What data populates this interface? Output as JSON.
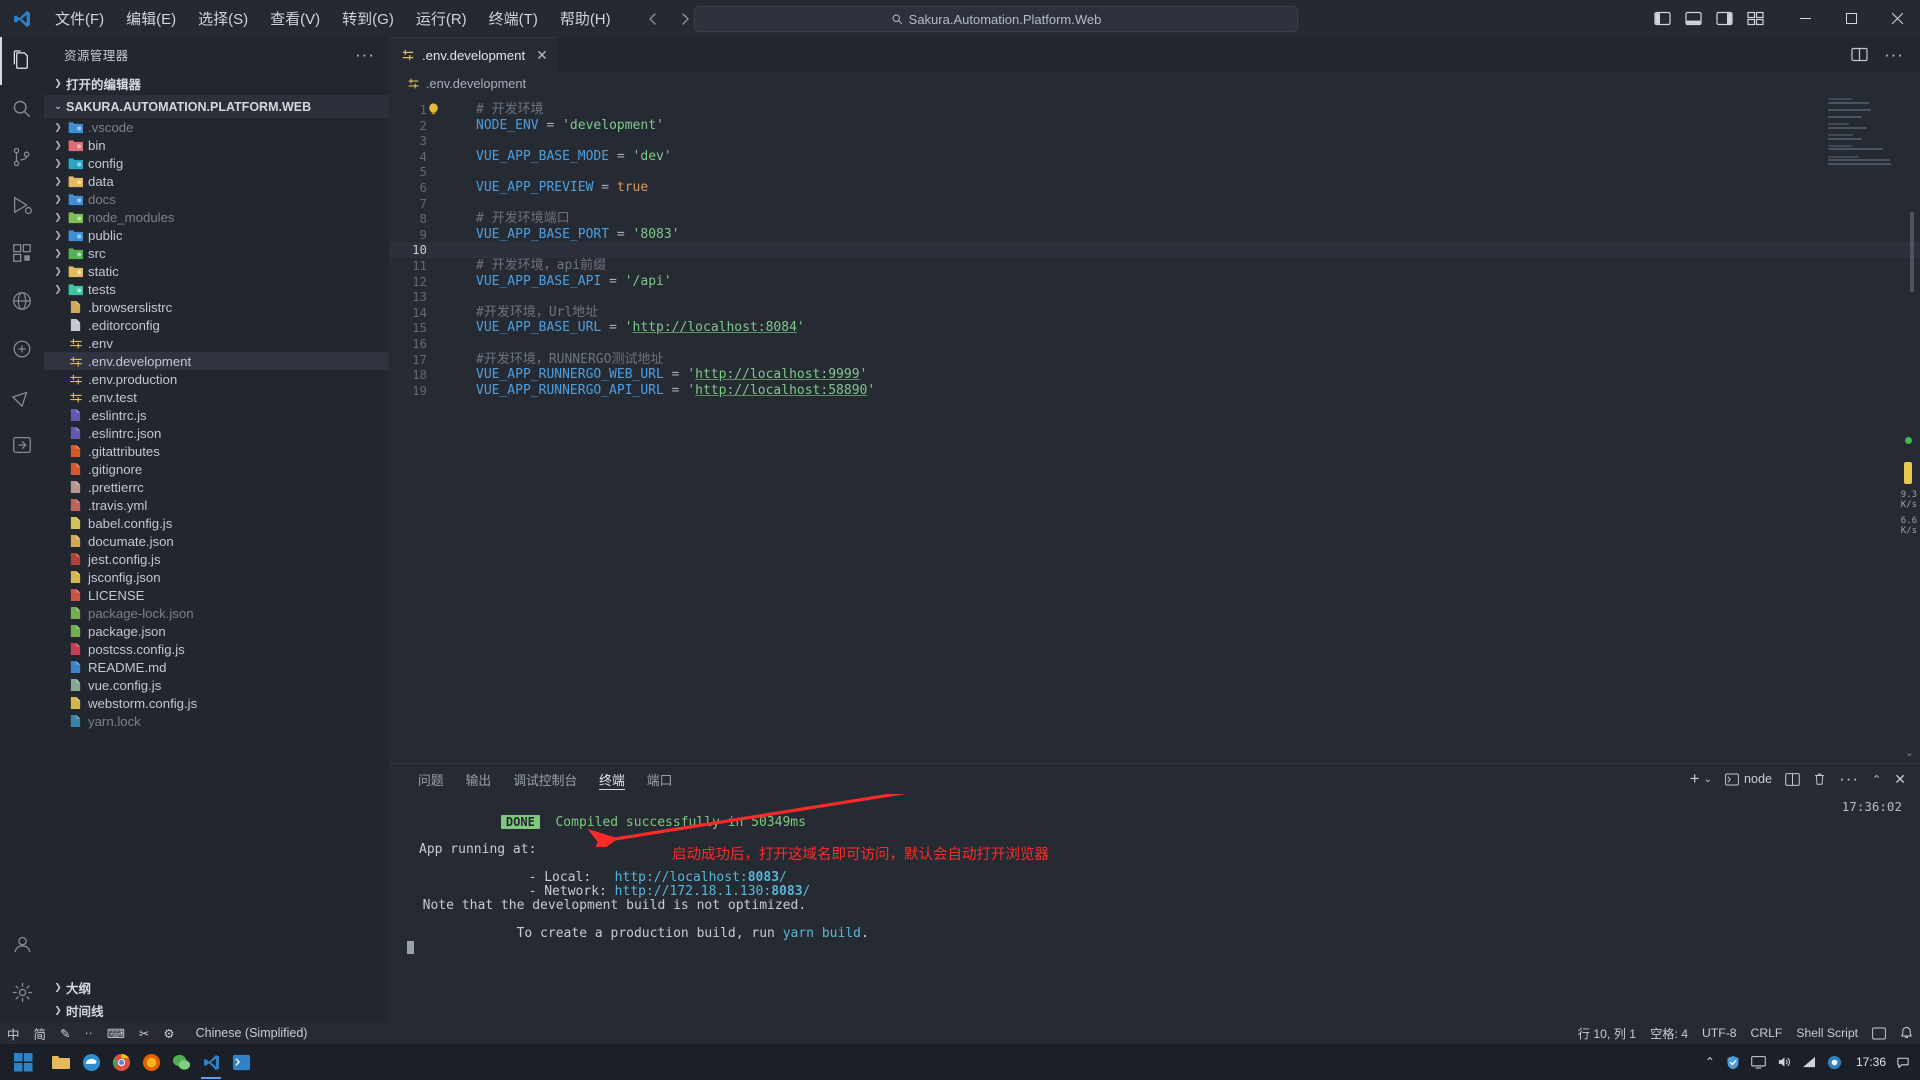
{
  "titlebar": {
    "logo_icon": "vscode-logo-icon",
    "menu": [
      {
        "label": "文件(F)",
        "name": "menu-file"
      },
      {
        "label": "编辑(E)",
        "name": "menu-edit"
      },
      {
        "label": "选择(S)",
        "name": "menu-selection"
      },
      {
        "label": "查看(V)",
        "name": "menu-view"
      },
      {
        "label": "转到(G)",
        "name": "menu-go"
      },
      {
        "label": "运行(R)",
        "name": "menu-run"
      },
      {
        "label": "终端(T)",
        "name": "menu-terminal"
      },
      {
        "label": "帮助(H)",
        "name": "menu-help"
      }
    ],
    "back_icon": "arrow-left-icon",
    "forward_icon": "arrow-right-icon",
    "command_center_text": "Sakura.Automation.Platform.Web",
    "command_center_icon": "search-icon",
    "window_controls": {
      "minimize": "─",
      "maximize": "▢",
      "close": "✕"
    }
  },
  "activitybar": {
    "items": [
      {
        "name": "activity-explorer",
        "icon": "files-icon",
        "active": true
      },
      {
        "name": "activity-search",
        "icon": "search-icon",
        "active": false
      },
      {
        "name": "activity-scm",
        "icon": "source-control-icon",
        "active": false
      },
      {
        "name": "activity-debug",
        "icon": "run-and-debug-icon",
        "active": false
      },
      {
        "name": "activity-extensions",
        "icon": "extensions-icon",
        "active": false
      },
      {
        "name": "activity-remote",
        "icon": "remote-explorer-icon",
        "active": false
      },
      {
        "name": "activity-docker",
        "icon": "docker-icon",
        "active": false
      },
      {
        "name": "activity-testing",
        "icon": "beaker-icon",
        "active": false
      },
      {
        "name": "activity-import",
        "icon": "import-icon",
        "active": false
      }
    ],
    "bottom": [
      {
        "name": "activity-accounts",
        "icon": "account-icon"
      },
      {
        "name": "activity-settings",
        "icon": "gear-icon"
      }
    ]
  },
  "sidebar": {
    "title": "资源管理器",
    "more_actions_icon": "ellipsis-icon",
    "open_editors_label": "打开的编辑器",
    "project_label": "SAKURA.AUTOMATION.PLATFORM.WEB",
    "tree": [
      {
        "label": ".vscode",
        "type": "folder",
        "icon_color": "#3f8fd8",
        "dim": true
      },
      {
        "label": "bin",
        "type": "folder",
        "icon_color": "#e06c75",
        "dim": false
      },
      {
        "label": "config",
        "type": "folder",
        "icon_color": "#2aa6c4",
        "dim": false
      },
      {
        "label": "data",
        "type": "folder",
        "icon_color": "#e5b95c",
        "dim": false
      },
      {
        "label": "docs",
        "type": "folder",
        "icon_color": "#3f8fd8",
        "dim": true
      },
      {
        "label": "node_modules",
        "type": "folder",
        "icon_color": "#7bbf56",
        "dim": true
      },
      {
        "label": "public",
        "type": "folder",
        "icon_color": "#3f8fd8",
        "dim": false
      },
      {
        "label": "src",
        "type": "folder",
        "icon_color": "#54b158",
        "dim": false
      },
      {
        "label": "static",
        "type": "folder",
        "icon_color": "#e5b95c",
        "dim": false
      },
      {
        "label": "tests",
        "type": "folder",
        "icon_color": "#3fc4a0",
        "dim": false
      },
      {
        "label": ".browserslistrc",
        "type": "file",
        "icon": "browserslist-icon",
        "icon_color": "#e5b95c",
        "dim": false
      },
      {
        "label": ".editorconfig",
        "type": "file",
        "icon": "editorconfig-icon",
        "icon_color": "#d6dbe3",
        "dim": false
      },
      {
        "label": ".env",
        "type": "file",
        "icon": "env-icon",
        "icon_color": "#e5b95c",
        "dim": false
      },
      {
        "label": ".env.development",
        "type": "file",
        "icon": "env-icon",
        "icon_color": "#e5b95c",
        "dim": false,
        "selected": true
      },
      {
        "label": ".env.production",
        "type": "file",
        "icon": "env-icon",
        "icon_color": "#e5b95c",
        "dim": false
      },
      {
        "label": ".env.test",
        "type": "file",
        "icon": "env-icon",
        "icon_color": "#e5b95c",
        "dim": false
      },
      {
        "label": ".eslintrc.js",
        "type": "file",
        "icon": "eslint-icon",
        "icon_color": "#6a5fc4",
        "dim": false
      },
      {
        "label": ".eslintrc.json",
        "type": "file",
        "icon": "eslint-icon",
        "icon_color": "#6a5fc4",
        "dim": false
      },
      {
        "label": ".gitattributes",
        "type": "file",
        "icon": "git-icon",
        "icon_color": "#e8612c",
        "dim": false
      },
      {
        "label": ".gitignore",
        "type": "file",
        "icon": "git-icon",
        "icon_color": "#e8612c",
        "dim": false
      },
      {
        "label": ".prettierrc",
        "type": "file",
        "icon": "prettier-icon",
        "icon_color": "#c9a3a0",
        "dim": false
      },
      {
        "label": ".travis.yml",
        "type": "file",
        "icon": "travis-icon",
        "icon_color": "#cf6a5a",
        "dim": false
      },
      {
        "label": "babel.config.js",
        "type": "file",
        "icon": "babel-icon",
        "icon_color": "#e5d35c",
        "dim": false
      },
      {
        "label": "documate.json",
        "type": "file",
        "icon": "json-icon",
        "icon_color": "#e5b95c",
        "dim": false
      },
      {
        "label": "jest.config.js",
        "type": "file",
        "icon": "jest-icon",
        "icon_color": "#c2443d",
        "dim": false
      },
      {
        "label": "jsconfig.json",
        "type": "file",
        "icon": "js-config-icon",
        "icon_color": "#e5c84c",
        "dim": false
      },
      {
        "label": "LICENSE",
        "type": "file",
        "icon": "license-icon",
        "icon_color": "#e05a45",
        "dim": false
      },
      {
        "label": "package-lock.json",
        "type": "file",
        "icon": "npm-icon",
        "icon_color": "#7bbf56",
        "dim": true
      },
      {
        "label": "package.json",
        "type": "file",
        "icon": "npm-icon",
        "icon_color": "#7bbf56",
        "dim": false
      },
      {
        "label": "postcss.config.js",
        "type": "file",
        "icon": "postcss-icon",
        "icon_color": "#d9415c",
        "dim": false
      },
      {
        "label": "README.md",
        "type": "file",
        "icon": "readme-icon",
        "icon_color": "#3f8fd8",
        "dim": false
      },
      {
        "label": "vue.config.js",
        "type": "file",
        "icon": "vue-config-icon",
        "icon_color": "#8fb9a3",
        "dim": false
      },
      {
        "label": "webstorm.config.js",
        "type": "file",
        "icon": "js-icon",
        "icon_color": "#e5c84c",
        "dim": false
      },
      {
        "label": "yarn.lock",
        "type": "file",
        "icon": "yarn-icon",
        "icon_color": "#3b8fb5",
        "dim": true
      }
    ],
    "footer": [
      {
        "label": "大纲",
        "name": "sidebar-section-outline"
      },
      {
        "label": "时间线",
        "name": "sidebar-section-timeline"
      }
    ]
  },
  "editor": {
    "tab": {
      "label": ".env.development",
      "icon": "env-icon",
      "close_icon": "close-icon"
    },
    "actions": {
      "split_icon": "split-editor-icon",
      "more_icon": "ellipsis-icon"
    },
    "breadcrumb": ".env.development",
    "lines": [
      {
        "n": 1,
        "tokens": [
          {
            "t": "# 开发环境",
            "c": "k-com"
          }
        ]
      },
      {
        "n": 2,
        "tokens": [
          {
            "t": "NODE_ENV",
            "c": "k-var"
          },
          {
            "t": " = ",
            "c": "k-op"
          },
          {
            "t": "'development'",
            "c": "k-str"
          }
        ]
      },
      {
        "n": 3,
        "tokens": []
      },
      {
        "n": 4,
        "tokens": [
          {
            "t": "VUE_APP_BASE_MODE",
            "c": "k-var"
          },
          {
            "t": " = ",
            "c": "k-op"
          },
          {
            "t": "'dev'",
            "c": "k-str"
          }
        ]
      },
      {
        "n": 5,
        "tokens": []
      },
      {
        "n": 6,
        "tokens": [
          {
            "t": "VUE_APP_PREVIEW",
            "c": "k-var"
          },
          {
            "t": " = ",
            "c": "k-op"
          },
          {
            "t": "true",
            "c": "k-bool"
          }
        ]
      },
      {
        "n": 7,
        "tokens": []
      },
      {
        "n": 8,
        "tokens": [
          {
            "t": "# 开发环境端口",
            "c": "k-com"
          }
        ]
      },
      {
        "n": 9,
        "tokens": [
          {
            "t": "VUE_APP_BASE_PORT",
            "c": "k-var"
          },
          {
            "t": " = ",
            "c": "k-op"
          },
          {
            "t": "'8083'",
            "c": "k-str"
          }
        ],
        "lightbulb": true
      },
      {
        "n": 10,
        "tokens": [],
        "current": true
      },
      {
        "n": 11,
        "tokens": [
          {
            "t": "# 开发环境，api前缀",
            "c": "k-com"
          }
        ]
      },
      {
        "n": 12,
        "tokens": [
          {
            "t": "VUE_APP_BASE_API",
            "c": "k-var"
          },
          {
            "t": " = ",
            "c": "k-op"
          },
          {
            "t": "'/api'",
            "c": "k-str"
          }
        ]
      },
      {
        "n": 13,
        "tokens": []
      },
      {
        "n": 14,
        "tokens": [
          {
            "t": "#开发环境，Url地址",
            "c": "k-com"
          }
        ]
      },
      {
        "n": 15,
        "tokens": [
          {
            "t": "VUE_APP_BASE_URL",
            "c": "k-var"
          },
          {
            "t": " = ",
            "c": "k-op"
          },
          {
            "t": "'",
            "c": "k-str"
          },
          {
            "t": "http://localhost:8084",
            "c": "k-url"
          },
          {
            "t": "'",
            "c": "k-str"
          }
        ]
      },
      {
        "n": 16,
        "tokens": []
      },
      {
        "n": 17,
        "tokens": [
          {
            "t": "#开发环境，RUNNERGO测试地址",
            "c": "k-com"
          }
        ]
      },
      {
        "n": 18,
        "tokens": [
          {
            "t": "VUE_APP_RUNNERGO_WEB_URL",
            "c": "k-var"
          },
          {
            "t": " = ",
            "c": "k-op"
          },
          {
            "t": "'",
            "c": "k-str"
          },
          {
            "t": "http://localhost:9999",
            "c": "k-url"
          },
          {
            "t": "'",
            "c": "k-str"
          }
        ]
      },
      {
        "n": 19,
        "tokens": [
          {
            "t": "VUE_APP_RUNNERGO_API_URL",
            "c": "k-var"
          },
          {
            "t": " = ",
            "c": "k-op"
          },
          {
            "t": "'",
            "c": "k-str"
          },
          {
            "t": "http://localhost:58890",
            "c": "k-url"
          },
          {
            "t": "'",
            "c": "k-str"
          }
        ]
      }
    ],
    "network_stats": [
      {
        "value": "9.3",
        "unit": "K/s"
      },
      {
        "value": "6.6",
        "unit": "K/s"
      }
    ]
  },
  "panel": {
    "tabs": [
      {
        "label": "问题",
        "name": "panel-tab-problems",
        "active": false
      },
      {
        "label": "输出",
        "name": "panel-tab-output",
        "active": false
      },
      {
        "label": "调试控制台",
        "name": "panel-tab-debug-console",
        "active": false
      },
      {
        "label": "终端",
        "name": "panel-tab-terminal",
        "active": true
      },
      {
        "label": "端口",
        "name": "panel-tab-ports",
        "active": false
      }
    ],
    "actions": {
      "new_terminal_icon": "plus-icon",
      "dropdown_icon": "chevron-down-icon",
      "shell_icon": "terminal-icon",
      "shell_label": "node",
      "split_icon": "split-terminal-icon",
      "kill_icon": "trash-icon",
      "more_icon": "ellipsis-icon",
      "maximize_icon": "chevron-up-icon",
      "close_icon": "close-icon"
    },
    "terminal": {
      "timestamp": "17:36:02",
      "done_badge": "DONE",
      "compiled_text": "Compiled successfully in 50349ms",
      "app_running_at": "App running at:",
      "local_label": "  - Local:   ",
      "local_url_prefix": "http://localhost:",
      "local_url_port": "8083",
      "local_url_suffix": "/",
      "network_label": "  - Network: ",
      "network_url_prefix": "http://172.18.1.130:",
      "network_url_port": "8083",
      "network_url_suffix": "/",
      "note_line1": "  Note that the development build is not optimized.",
      "note_line2_a": "  To create a production build, run ",
      "note_line2_b": "yarn build",
      "note_line2_c": "."
    },
    "annotation": "启动成功后，打开这域名即可访问，默认会自动打开浏览器"
  },
  "statusbar": {
    "left": [
      {
        "label": "中",
        "name": "status-ime-cn"
      },
      {
        "label": "简",
        "name": "status-ime-simplified"
      },
      {
        "label": "✎",
        "name": "status-ime-pen"
      },
      {
        "label": "··",
        "name": "status-ime-dots"
      },
      {
        "label": "⌨",
        "name": "status-ime-keyboard"
      },
      {
        "label": "✂",
        "name": "status-ime-tools"
      },
      {
        "label": "⚙",
        "name": "status-ime-settings"
      },
      {
        "label": "Chinese (Simplified)",
        "name": "status-ime-language"
      }
    ],
    "right": [
      {
        "label": "行 10, 列 1",
        "name": "status-cursor-position"
      },
      {
        "label": "空格: 4",
        "name": "status-indentation"
      },
      {
        "label": "UTF-8",
        "name": "status-encoding"
      },
      {
        "label": "CRLF",
        "name": "status-eol"
      },
      {
        "label": "Shell Script",
        "name": "status-language-mode"
      },
      {
        "label": "⧉",
        "name": "status-screencast-icon"
      },
      {
        "label": "🔔",
        "name": "status-notifications-icon"
      }
    ]
  },
  "taskbar": {
    "start_icon": "windows-start-icon",
    "apps": [
      {
        "name": "taskbar-file-explorer",
        "icon": "folder-icon",
        "color": "#e5b95c"
      },
      {
        "name": "taskbar-edge",
        "icon": "edge-icon",
        "color": "#3aa0d8"
      },
      {
        "name": "taskbar-chrome",
        "icon": "chrome-icon",
        "color": "#dd5144"
      },
      {
        "name": "taskbar-firefox",
        "icon": "firefox-icon",
        "color": "#e66000"
      },
      {
        "name": "taskbar-wechat",
        "icon": "wechat-icon",
        "color": "#4caf50"
      },
      {
        "name": "taskbar-vscode",
        "icon": "vscode-icon",
        "color": "#2f82c6",
        "active": true
      },
      {
        "name": "taskbar-terminal",
        "icon": "terminal-app-icon",
        "color": "#2f82c6"
      }
    ],
    "tray": [
      {
        "name": "tray-chevron-up-icon",
        "glyph": "⌃"
      },
      {
        "name": "tray-shield-icon",
        "glyph": "🛡"
      },
      {
        "name": "tray-screen-icon",
        "glyph": "▭"
      },
      {
        "name": "tray-volume-icon",
        "glyph": "🔊"
      },
      {
        "name": "tray-network-icon",
        "glyph": "▰"
      },
      {
        "name": "tray-app-icon",
        "glyph": "◉"
      }
    ],
    "clock": "17:36",
    "notification_icon": "notification-icon"
  }
}
